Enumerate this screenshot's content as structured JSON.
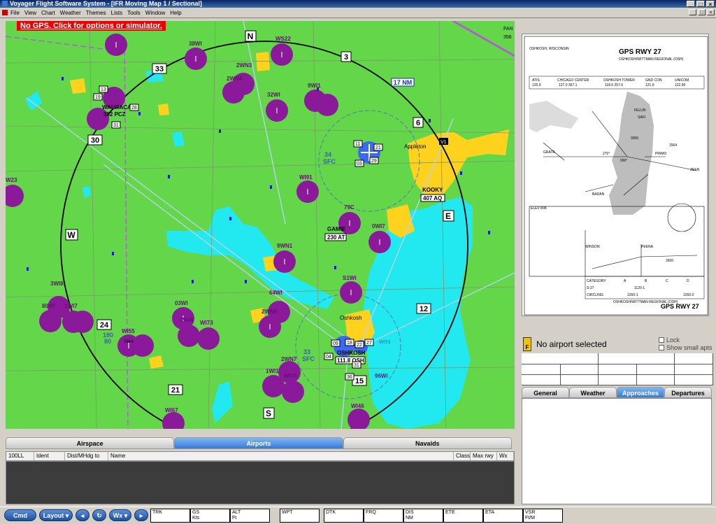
{
  "window": {
    "title": "Voyager Flight Software System - [IFR Moving Map 1 / Sectional]",
    "controls": [
      "_",
      "□",
      "×"
    ],
    "mdi_controls": [
      "_",
      "□",
      "×"
    ]
  },
  "menu": [
    "File",
    "View",
    "Chart",
    "Weather",
    "Themes",
    "Lists",
    "Tools",
    "Window",
    "Help"
  ],
  "map": {
    "gps_warning": "No GPS.  Click for options or simulator.",
    "range_label": "17 NM",
    "compass": {
      "N": "N",
      "E": "E",
      "S": "S",
      "W": "W",
      "r3": "3",
      "r6": "6",
      "r12": "12",
      "r15": "15",
      "r21": "21",
      "r24": "24",
      "r30": "30",
      "r33": "33"
    },
    "airports": [
      "WS22",
      "38WI",
      "2WN3",
      "2WN4",
      "32WI",
      "9WI1",
      "WI91",
      "79C",
      "0WI7",
      "9WN1",
      "S1WI",
      "64WI",
      "3WI8",
      "80WI",
      "1WI7",
      "03WI",
      "WI48",
      "WI73",
      "2WN8",
      "WI55",
      "2WN7",
      "1WI1",
      "WI74",
      "96WI",
      "WI46",
      "WI67",
      "W23"
    ],
    "fixes": {
      "wauraca": "WAURACA",
      "wauraca_alt": "382 PCZ",
      "kooky": "KOOKY",
      "kooky_alt": "407 AQ",
      "gamie": "GAMIE",
      "gamie_alt": "230 AT",
      "oshkosh": "OSHKOSH",
      "oshkosh_alt": "111.8 OSH"
    },
    "towns": {
      "appleton": "Appleton",
      "oshkosh": "Oshkosh"
    },
    "airspace": {
      "a1": "34",
      "a1b": "SFC",
      "a2": "33",
      "a2b": "SFC",
      "mva": "180",
      "mva2": "80"
    },
    "runway_nums": [
      "13",
      "19",
      "28",
      "31",
      "11",
      "21",
      "03",
      "29",
      "09",
      "18",
      "22",
      "27",
      "04",
      "31",
      "36"
    ],
    "edge": [
      "FAN",
      "356",
      "V1",
      "N44",
      "WI53"
    ]
  },
  "plate": {
    "title": "GPS RWY 27",
    "location": "OSHKOSH, WISCONSIN",
    "airport": "OSHKOSH/WITTMAN REGIONAL (OSH)",
    "freqs": [
      "ATIS",
      "125.9",
      "CHICAGO CENTER",
      "127.0 367.1",
      "OSHKOSH TOWER",
      "118.5 257.6",
      "GND CON",
      "121.9",
      "UNICOM",
      "122.95"
    ],
    "labels": [
      "GRATE",
      "PRIMO",
      "BADAN",
      "SAFI",
      "FELUN",
      "ZEEN",
      "WINSON",
      "PEENA",
      "2600",
      "3000",
      "270°",
      "090°",
      "1564",
      "ELEV 808"
    ],
    "minimums": [
      "CATEGORY",
      "A",
      "B",
      "C",
      "D",
      "S-27",
      "1120-1",
      "CIRCLING",
      "1260-1",
      "1260-2"
    ],
    "bottom_title": "GPS RWY 27",
    "bottom_airport": "OSHKOSH/WITTMAN REGIONAL (OSH)"
  },
  "info": {
    "no_airport": "No airport selected",
    "lock": "Lock",
    "show_small": "Show small apts"
  },
  "right_tabs": [
    "General",
    "Weather",
    "Approaches",
    "Departures"
  ],
  "right_active": 2,
  "bottom_tabs": [
    "Airspace",
    "Airports",
    "Navaids"
  ],
  "bottom_active": 1,
  "grid_columns": [
    "100LL",
    "Ident",
    "Dist/MHdg to",
    "Name",
    "Class",
    "Max rwy",
    "Wx"
  ],
  "toolbar": {
    "cmd": "Cmd",
    "layout": "Layout",
    "wx": "Wx"
  },
  "fields": [
    {
      "a": "TRK",
      "b": ""
    },
    {
      "a": "GS",
      "b": "Kts"
    },
    {
      "a": "ALT",
      "b": "Ft"
    },
    {
      "a": "WPT",
      "b": ""
    },
    {
      "a": "DTK",
      "b": ""
    },
    {
      "a": "FRQ",
      "b": ""
    },
    {
      "a": "DIS",
      "b": "NM"
    },
    {
      "a": "ETE",
      "b": ""
    },
    {
      "a": "ETA",
      "b": ""
    },
    {
      "a": "VSR",
      "b": "Ft/M"
    }
  ],
  "colors": {
    "map_green": "#64d64a",
    "water": "#22e8f0",
    "airport_purple": "#8b1a9a",
    "town_yellow": "#ffd21e",
    "towered_blue": "#3a6af0",
    "tab_active": "#3779d9"
  }
}
